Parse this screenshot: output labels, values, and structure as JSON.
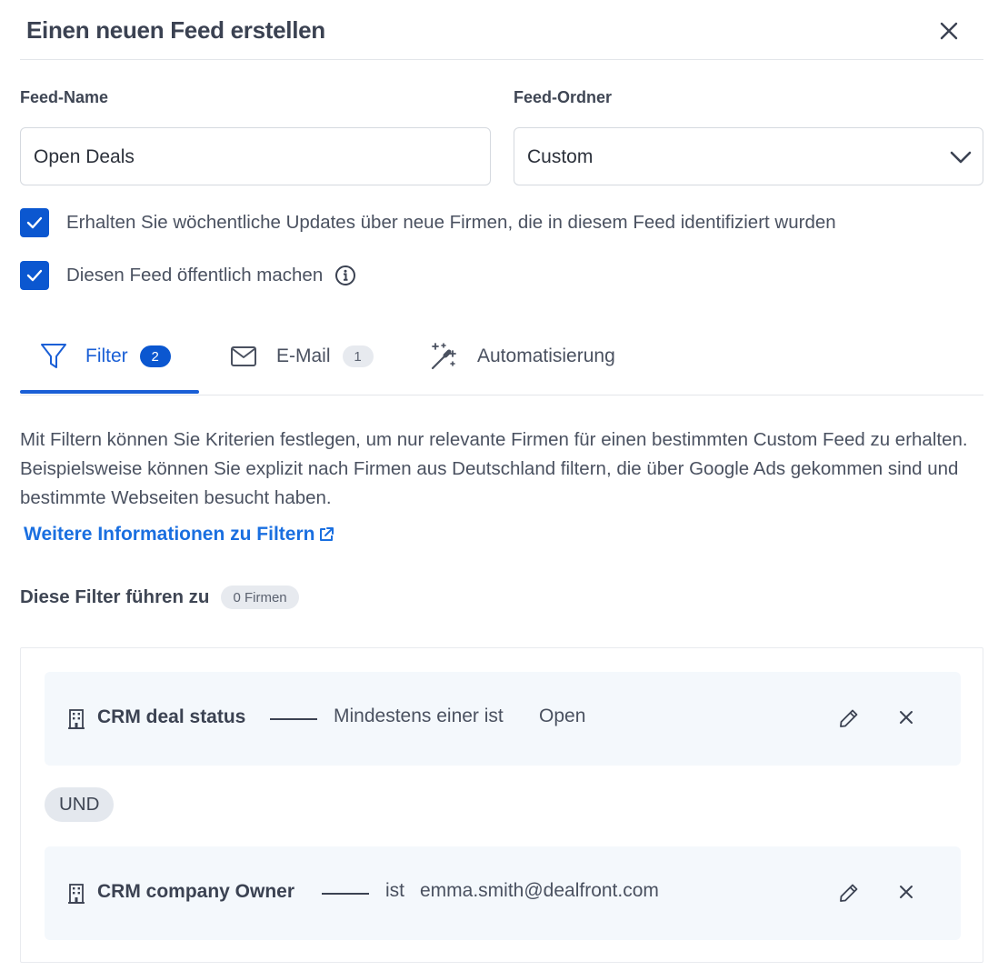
{
  "dialog": {
    "title": "Einen neuen Feed erstellen",
    "close_icon": "close-icon"
  },
  "form": {
    "name_label": "Feed-Name",
    "name_value": "Open Deals",
    "folder_label": "Feed-Ordner",
    "folder_value": "Custom"
  },
  "options": {
    "weekly_updates": {
      "label": "Erhalten Sie wöchentliche Updates über neue Firmen, die in diesem Feed identifiziert wurden",
      "checked": true
    },
    "public": {
      "label": "Diesen Feed öffentlich machen",
      "checked": true
    }
  },
  "tabs": [
    {
      "label": "Filter",
      "badge": "2",
      "icon": "filter-icon",
      "active": true
    },
    {
      "label": "E-Mail",
      "badge": "1",
      "icon": "envelope-icon",
      "active": false
    },
    {
      "label": "Automatisierung",
      "icon": "magic-wand-icon",
      "active": false
    }
  ],
  "filters_tab": {
    "description": "Mit Filtern können Sie Kriterien festlegen, um nur relevante Firmen für einen bestimmten Custom Feed zu erhalten. Beispielsweise können Sie explizit nach Firmen aus Deutschland filtern, die über Google Ads gekommen sind und bestimmte Webseiten besucht haben.",
    "link_text": "Weitere Informationen zu Filtern",
    "result_label": "Diese Filter führen zu",
    "result_count": "0 Firmen",
    "filters": [
      {
        "field": "CRM deal status",
        "operator": "Mindestens einer ist",
        "value": "Open"
      },
      {
        "field": "CRM company Owner",
        "operator": "ist",
        "value": "emma.smith@dealfront.com"
      }
    ],
    "connector": "UND"
  },
  "colors": {
    "accent": "#0b57d0",
    "link": "#1a6fe0",
    "card_bg": "#f4f8fc"
  }
}
